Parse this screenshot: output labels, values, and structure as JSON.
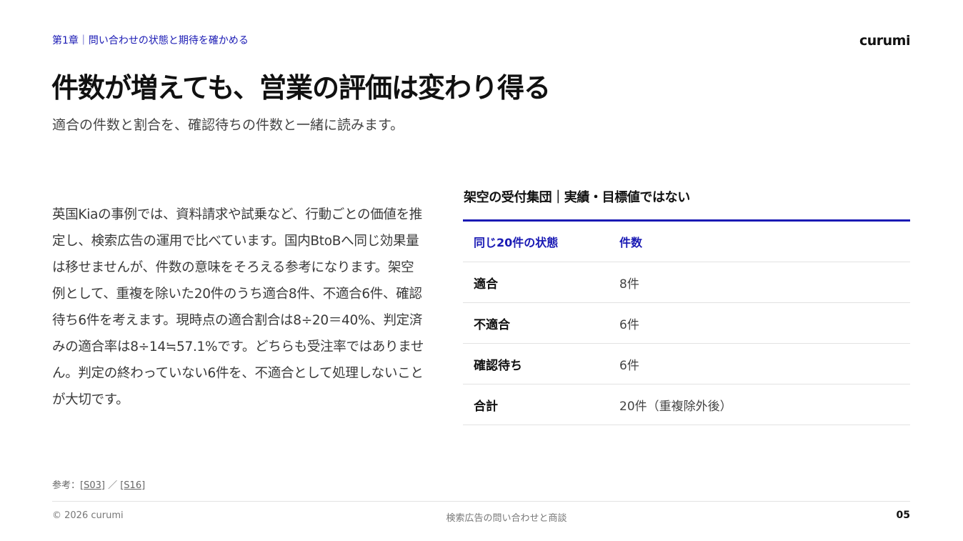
{
  "header": {
    "chapter": "第1章｜問い合わせの状態と期待を確かめる",
    "brand": "curumi"
  },
  "title": "件数が増えても、営業の評価は変わり得る",
  "subtitle": "適合の件数と割合を、確認待ちの件数と一緒に読みます。",
  "body": "英国Kiaの事例では、資料請求や試乗など、行動ごとの価値を推定し、検索広告の運用で比べています。国内BtoBへ同じ効果量は移せませんが、件数の意味をそろえる参考になります。架空例として、重複を除いた20件のうち適合8件、不適合6件、確認待ち6件を考えます。現時点の適合割合は8÷20＝40%、判定済みの適合率は8÷14≒57.1%です。どちらも受注率ではありません。判定の終わっていない6件を、不適合として処理しないことが大切です。",
  "table": {
    "caption": "架空の受付集団｜実績・目標値ではない",
    "headers": [
      "同じ20件の状態",
      "件数"
    ],
    "rows": [
      {
        "status": "適合",
        "count": "8件"
      },
      {
        "status": "不適合",
        "count": "6件"
      },
      {
        "status": "確認待ち",
        "count": "6件"
      },
      {
        "status": "合計",
        "count": "20件（重複除外後）"
      }
    ]
  },
  "references": {
    "prefix": "参考：",
    "links": [
      "[S03]",
      "[S16]"
    ],
    "separator": " ／ "
  },
  "footer": {
    "copyright": "© 2026 curumi",
    "deck_title": "検索広告の問い合わせと商談",
    "page": "05"
  },
  "colors": {
    "accent": "#1a1ab4",
    "text": "#111111",
    "muted": "#777777",
    "rule": "#e2e2e2"
  }
}
